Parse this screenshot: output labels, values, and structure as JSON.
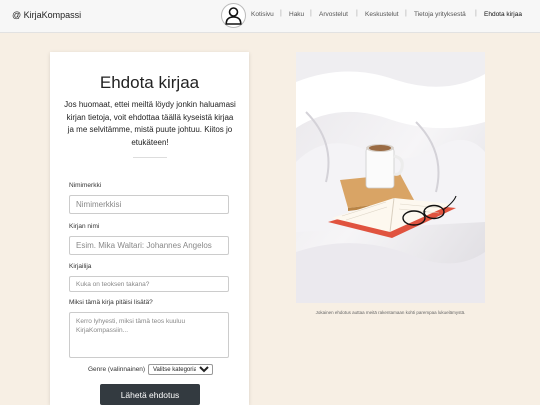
{
  "header": {
    "brand": "@ KirjaKompassi",
    "nav": [
      {
        "label": "Kotisivu"
      },
      {
        "label": "Haku"
      },
      {
        "label": "Arvostelut"
      },
      {
        "label": "Keskustelut"
      },
      {
        "label": "Tietoja yrityksestä"
      },
      {
        "label": "Ehdota kirjaa"
      }
    ],
    "separator": "|"
  },
  "form": {
    "title": "Ehdota kirjaa",
    "intro": "Jos huomaat, ettei meiltä löydy jonkin haluamasi kirjan tietoja, voit ehdottaa täällä kyseistä kirjaa ja me selvitämme, mistä puute johtuu. Kiitos jo etukäteen!",
    "nickname": {
      "label": "Nimimerkki",
      "placeholder": "Nimimerkkisi"
    },
    "book_name": {
      "label": "Kirjan nimi",
      "placeholder": "Esim. Mika Waltari: Johannes Angelos"
    },
    "author": {
      "label": "Kirjailija",
      "placeholder": "Kuka on teoksen takana?"
    },
    "reason": {
      "label": "Miksi tämä kirja pitäisi lisätä?",
      "placeholder": "Kerro lyhyesti, miksi tämä teos kuuluu KirjaKompassiin..."
    },
    "genre": {
      "label": "Genre (valinnainen)",
      "selected": "Valitse kategoria..."
    },
    "submit_label": "Lähetä ehdotus"
  },
  "image": {
    "caption": "Jokainen ehdotus auttaa meitä rakentamaan kohti parempaa lukuelämystä.",
    "alt": "Avoin kirja ja kahvikuppi sängyllä"
  },
  "colors": {
    "page_bg": "#f7efe4",
    "button_bg": "#333a40",
    "book_cover": "#e0533f"
  },
  "icons": {
    "avatar": "user-avatar-icon"
  }
}
